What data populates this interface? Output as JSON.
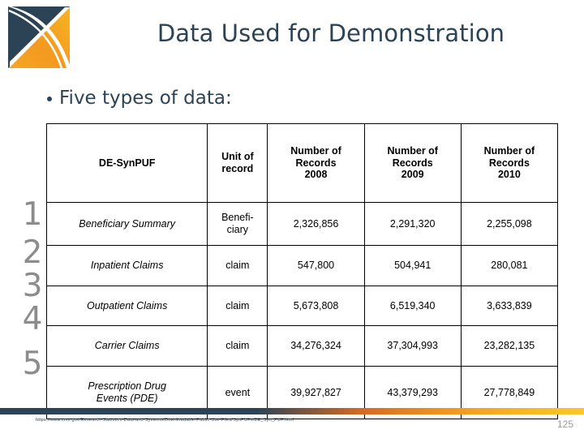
{
  "slide": {
    "title": "Data Used for Demonstration",
    "bullet": "Five types of data:",
    "page_number": "125",
    "footer_url": "https://www.cms.gov/Research-Statistics-Data-and-Systems/Downloadable-Public-Use-Files/SynPUFs/DE_Syn_PUF.html"
  },
  "logo": {
    "name": "x-mark-logo",
    "navy": "#2c4356",
    "orange": "#f0941f",
    "gold": "#fbc62a"
  },
  "colors": {
    "title_navy": "#2c4356",
    "numeral_gray": "#8c8c8c",
    "page_gray": "#9a9a9a",
    "table_border": "#000000"
  },
  "numerals": [
    "1",
    "2",
    "3",
    "4",
    "5"
  ],
  "table": {
    "headers": [
      "DE-SynPUF",
      "Unit of record",
      "Number of Records 2008",
      "Number of Records 2009",
      "Number of Records 2010"
    ],
    "header_lines": {
      "c0": [
        "DE-SynPUF"
      ],
      "c1": [
        "Unit of",
        "record"
      ],
      "c2": [
        "Number of",
        "Records",
        "2008"
      ],
      "c3": [
        "Number of",
        "Records",
        "2009"
      ],
      "c4": [
        "Number of",
        "Records",
        "2010"
      ]
    },
    "rows": [
      {
        "label": "Beneficiary Summary",
        "unit": "Benefi-ciary",
        "unit_l1": "Benefi-",
        "unit_l2": "ciary",
        "y2008": "2,326,856",
        "y2009": "2,291,320",
        "y2010": "2,255,098"
      },
      {
        "label": "Inpatient Claims",
        "unit": "claim",
        "y2008": "547,800",
        "y2009": "504,941",
        "y2010": "280,081"
      },
      {
        "label": "Outpatient Claims",
        "unit": "claim",
        "y2008": "5,673,808",
        "y2009": "6,519,340",
        "y2010": "3,633,839"
      },
      {
        "label": "Carrier Claims",
        "unit": "claim",
        "y2008": "34,276,324",
        "y2009": "37,304,993",
        "y2010": "23,282,135"
      },
      {
        "label_l1": "Prescription Drug",
        "label_l2": "Events (PDE)",
        "label": "Prescription Drug Events (PDE)",
        "unit": "event",
        "y2008": "39,927,827",
        "y2009": "43,379,293",
        "y2010": "27,778,849"
      }
    ]
  }
}
